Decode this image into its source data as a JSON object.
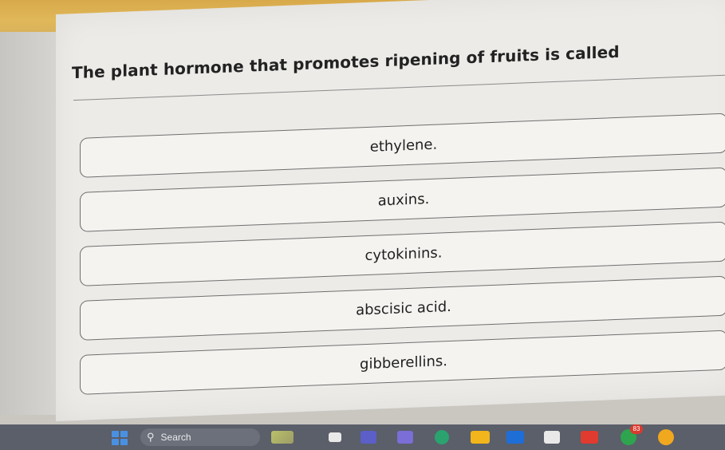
{
  "quiz": {
    "question": "The plant hormone that promotes ripening of fruits is called",
    "options": [
      {
        "label": "ethylene."
      },
      {
        "label": "auxins."
      },
      {
        "label": "cytokinins."
      },
      {
        "label": "abscisic acid."
      },
      {
        "label": "gibberellins."
      }
    ]
  },
  "taskbar": {
    "search_label": "Search",
    "badge_count": "83",
    "icons": [
      "windows-start-icon",
      "search-icon",
      "widgets-icon",
      "app-icon",
      "teams-icon",
      "app-icon",
      "edge-icon",
      "file-explorer-icon",
      "outlook-icon",
      "app-icon",
      "youtube-icon",
      "whatsapp-icon",
      "chrome-icon"
    ]
  },
  "colors": {
    "card": "#ecebe8",
    "option_border": "#6f6f6f",
    "taskbar": "#5a5f6a",
    "wall_top": "#d8a94a"
  }
}
